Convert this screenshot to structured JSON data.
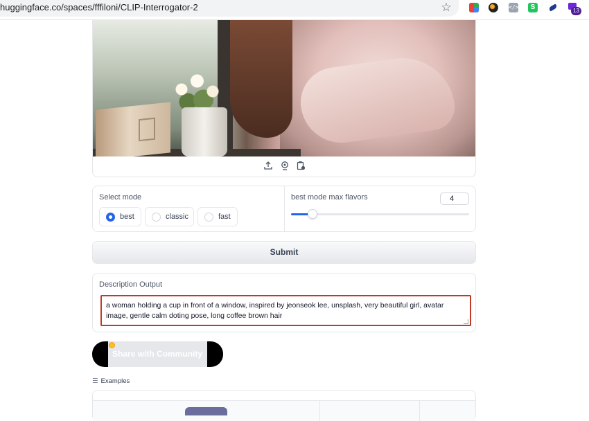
{
  "browser": {
    "url": "huggingface.co/spaces/fffiloni/CLIP-Interrogator-2",
    "star_icon": "star-icon",
    "extensions": [
      "google-extension-icon",
      "dark-circle-extension-icon",
      "code-extension-icon",
      "s-extension-icon",
      "pen-extension-icon",
      "purple-extension-icon"
    ],
    "extension_code_glyph": "</>",
    "extension_s_glyph": "S",
    "badge_count": "13"
  },
  "image_tools": {
    "upload_icon": "upload-icon",
    "webcam_icon": "webcam-icon",
    "clipboard_icon": "clipboard-icon"
  },
  "mode": {
    "label": "Select mode",
    "options": [
      {
        "label": "best",
        "selected": true
      },
      {
        "label": "classic",
        "selected": false
      },
      {
        "label": "fast",
        "selected": false
      }
    ]
  },
  "flavors": {
    "label": "best mode max flavors",
    "value": "4",
    "slider_fraction": 0.12
  },
  "submit": {
    "label": "Submit"
  },
  "output": {
    "label": "Description Output",
    "text": "a woman holding a cup in front of a window, inspired by jeonseok lee, unsplash, very beautiful girl, avatar image, gentle calm doting pose, long coffee brown hair"
  },
  "share": {
    "label": "Share with Community"
  },
  "examples": {
    "label": "Examples",
    "icon": "list-icon"
  },
  "colors": {
    "accent": "#2563eb",
    "highlight_border": "#c0392b"
  }
}
